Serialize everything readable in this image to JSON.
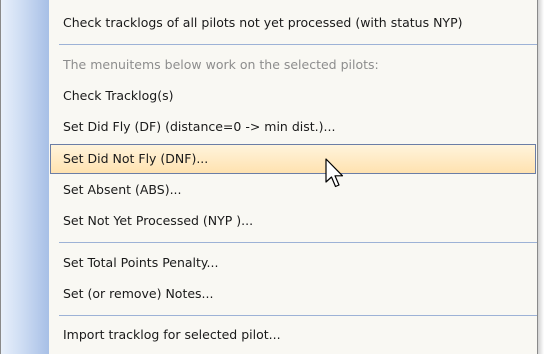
{
  "menu": {
    "items": [
      {
        "label": "Check tracklogs of all pilots not yet processed (with status NYP)"
      },
      {
        "label": "The menuitems below work on the selected pilots:"
      },
      {
        "label": "Check Tracklog(s)"
      },
      {
        "label": "Set Did Fly (DF) (distance=0 -> min dist.)..."
      },
      {
        "label": "Set Did Not Fly (DNF)..."
      },
      {
        "label": "Set Absent (ABS)..."
      },
      {
        "label": "Set Not Yet Processed (NYP )..."
      },
      {
        "label": "Set Total Points Penalty..."
      },
      {
        "label": "Set (or remove) Notes..."
      },
      {
        "label": "Import tracklog for selected pilot..."
      }
    ]
  },
  "colors": {
    "menu_background": "#f9f8f3",
    "gutter_gradient_end": "#a7bfe6",
    "highlight_top": "#fff4dc",
    "highlight_bottom": "#ffe2b0",
    "highlight_border": "#6b7ea6",
    "disabled_text": "#8d8d8d",
    "separator": "#9db2d6"
  },
  "icons": {
    "cursor": "mouse-pointer-icon"
  }
}
